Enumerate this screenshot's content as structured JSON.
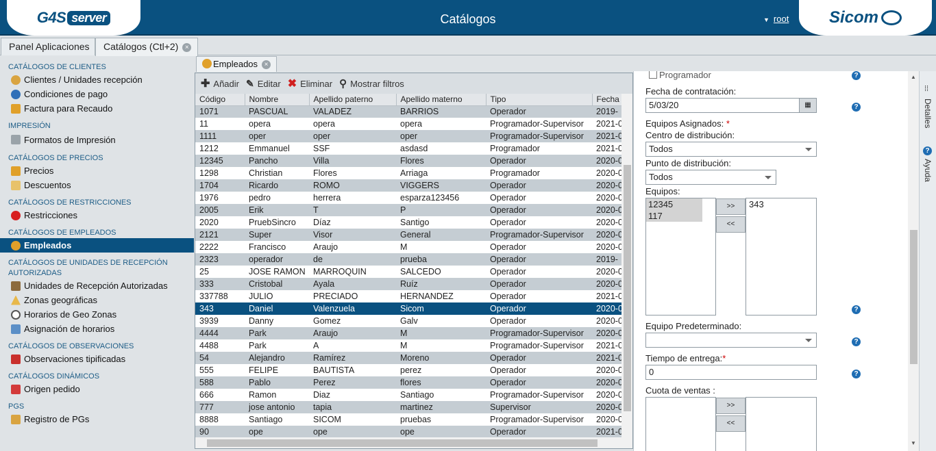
{
  "header": {
    "logo_left": "G4S",
    "logo_left_b": "server",
    "title": "Catálogos",
    "user": "root",
    "logo_right": "Sicom"
  },
  "main_tabs": [
    {
      "label": "Panel Aplicaciones"
    },
    {
      "label": "Catálogos (Ctl+2)"
    }
  ],
  "sidebar": {
    "sections": [
      {
        "title": "CATÁLOGOS DE CLIENTES",
        "items": [
          "Clientes / Unidades recepción",
          "Condiciones de pago",
          "Factura para Recaudo"
        ]
      },
      {
        "title": "IMPRESIÓN",
        "items": [
          "Formatos de Impresión"
        ]
      },
      {
        "title": "CATÁLOGOS DE PRECIOS",
        "items": [
          "Precios",
          "Descuentos"
        ]
      },
      {
        "title": "CATÁLOGOS DE RESTRICCIONES",
        "items": [
          "Restricciones"
        ]
      },
      {
        "title": "CATÁLOGOS DE EMPLEADOS",
        "items": [
          "Empleados"
        ]
      },
      {
        "title": "CATÁLOGOS DE UNIDADES DE RECEPCIÓN",
        "title2": "AUTORIZADAS",
        "items": [
          "Unidades de Recepción Autorizadas",
          "Zonas geográficas",
          "Horarios de Geo Zonas",
          "Asignación de horarios"
        ]
      },
      {
        "title": "CATÁLOGOS DE OBSERVACIONES",
        "items": [
          "Observaciones tipificadas"
        ]
      },
      {
        "title": "CATÁLOGOS DINÁMICOS",
        "items": [
          "Origen pedido"
        ]
      },
      {
        "title": "PGS",
        "items": [
          "Registro de PGs"
        ]
      }
    ]
  },
  "content_tab": {
    "label": "Empleados"
  },
  "toolbar": {
    "add": "Añadir",
    "edit": "Editar",
    "delete": "Eliminar",
    "filters": "Mostrar filtros"
  },
  "grid": {
    "columns": [
      "Código",
      "Nombre",
      "Apellido paterno",
      "Apellido materno",
      "Tipo",
      "Fecha d"
    ],
    "rows": [
      [
        "1071",
        "PASCUAL",
        "VALADEZ",
        "BARRIOS",
        "Operador",
        "2019-"
      ],
      [
        "11",
        "opera",
        "opera",
        "opera",
        "Programador-Supervisor",
        "2021-0"
      ],
      [
        "1111",
        "oper",
        "oper",
        "oper",
        "Programador-Supervisor",
        "2021-0"
      ],
      [
        "1212",
        "Emmanuel",
        "SSF",
        "asdasd",
        "Programador",
        "2021-0"
      ],
      [
        "12345",
        "Pancho",
        "Villa",
        "Flores",
        "Operador",
        "2020-0"
      ],
      [
        "1298",
        "Christian",
        "Flores",
        "Arriaga",
        "Programador",
        "2020-0"
      ],
      [
        "1704",
        "Ricardo",
        "ROMO",
        "VIGGERS",
        "Operador",
        "2020-0"
      ],
      [
        "1976",
        "pedro",
        "herrera",
        "esparza123456",
        "Operador",
        "2020-0"
      ],
      [
        "2005",
        "Erik",
        "T",
        "P",
        "Operador",
        "2020-0"
      ],
      [
        "2020",
        "PruebSincro",
        "Díaz",
        "Santigo",
        "Operador",
        "2020-0"
      ],
      [
        "2121",
        "Super",
        "Visor",
        "General",
        "Programador-Supervisor",
        "2020-0"
      ],
      [
        "2222",
        "Francisco",
        "Araujo",
        "M",
        "Operador",
        "2020-0"
      ],
      [
        "2323",
        "operador",
        "de",
        "prueba",
        "Operador",
        "2019-"
      ],
      [
        "25",
        "JOSE RAMON",
        "MARROQUIN",
        "SALCEDO",
        "Operador",
        "2020-0"
      ],
      [
        "333",
        "Cristobal",
        "Ayala",
        "Ruíz",
        "Operador",
        "2020-0"
      ],
      [
        "337788",
        "JULIO",
        "PRECIADO",
        "HERNANDEZ",
        "Operador",
        "2021-0"
      ],
      [
        "343",
        "Daniel",
        "Valenzuela",
        "Sicom",
        "Operador",
        "2020-0"
      ],
      [
        "3939",
        "Danny",
        "Gomez",
        "Galv",
        "Operador",
        "2020-0"
      ],
      [
        "4444",
        "Park",
        "Araujo",
        "M",
        "Programador-Supervisor",
        "2020-0"
      ],
      [
        "4488",
        "Park",
        "A",
        "M",
        "Programador-Supervisor",
        "2021-0"
      ],
      [
        "54",
        "Alejandro",
        "Ramírez",
        "Moreno",
        "Operador",
        "2021-0"
      ],
      [
        "555",
        "FELIPE",
        "BAUTISTA",
        "perez",
        "Operador",
        "2020-0"
      ],
      [
        "588",
        "Pablo",
        "Perez",
        "flores",
        "Operador",
        "2020-0"
      ],
      [
        "666",
        "Ramon",
        "Diaz",
        "Santiago",
        "Programador-Supervisor",
        "2020-0"
      ],
      [
        "777",
        "jose antonio",
        "tapia",
        "martinez",
        "Supervisor",
        "2020-0"
      ],
      [
        "8888",
        "Santiago",
        "SICOM",
        "pruebas",
        "Programador-Supervisor",
        "2020-0"
      ],
      [
        "90",
        "ope",
        "ope",
        "ope",
        "Operador",
        "2021-0"
      ]
    ],
    "selected_code": "343"
  },
  "details": {
    "programador_label": "Programador",
    "fecha_label": "Fecha de contratación:",
    "fecha_value": "5/03/20",
    "equipos_asignados_label": "Equipos Asignados:",
    "centro_label": "Centro de distribución:",
    "centro_value": "Todos",
    "punto_label": "Punto de distribución:",
    "punto_value": "Todos",
    "equipos_label": "Equipos:",
    "equipos_available": [
      "12345",
      "117"
    ],
    "equipos_assigned": [
      "343"
    ],
    "move_right": ">>",
    "move_left": "<<",
    "equipo_pred_label": "Equipo Predeterminado:",
    "equipo_pred_value": "",
    "tiempo_label": "Tiempo de entrega:",
    "tiempo_value": "0",
    "cuota_label": "Cuota de ventas :",
    "required_mark": "*"
  },
  "right_rail": {
    "detalles": "Detalles",
    "ayuda": "Ayuda"
  }
}
